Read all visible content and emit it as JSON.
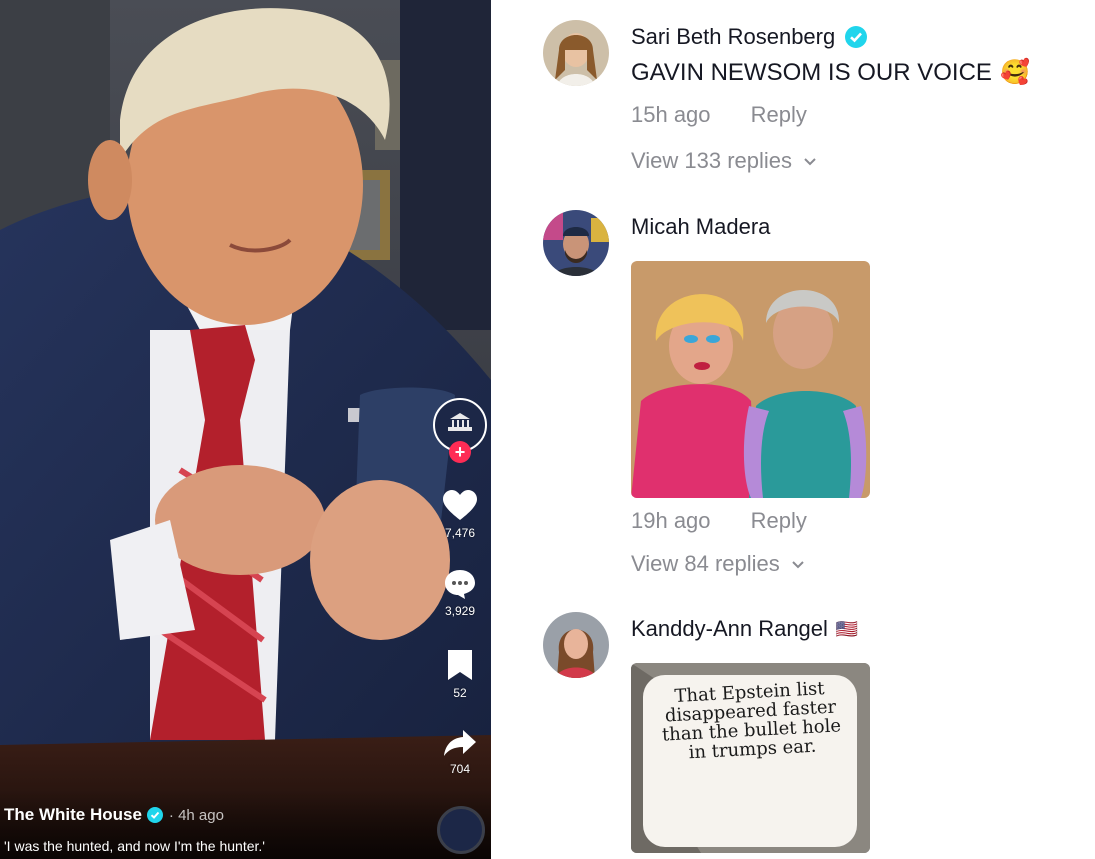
{
  "video": {
    "creator_name": "The White House",
    "posted_time": "· 4h ago",
    "caption": "'I was the hunted, and now I'm the hunter.'",
    "creator_logo_text": "THE WHITE HOUSE",
    "likes": "7,476",
    "comments": "3,929",
    "saves": "52",
    "shares": "704"
  },
  "comments": [
    {
      "author": "Sari Beth Rosenberg",
      "verified": true,
      "text": "GAVIN NEWSOM IS OUR VOICE",
      "emoji": "🥰",
      "time": "15h ago",
      "reply_label": "Reply",
      "view_replies": "View 133 replies"
    },
    {
      "author": "Micah Madera",
      "time": "19h ago",
      "reply_label": "Reply",
      "view_replies": "View 84 replies"
    },
    {
      "author": "Kanddy-Ann Rangel",
      "flag": "🇺🇸",
      "image_text": "That Epstein list disappeared faster than the bullet hole in trumps ear."
    }
  ],
  "icons": {
    "like": "heart-icon",
    "comment": "comment-bubble-icon",
    "save": "bookmark-icon",
    "share": "share-arrow-icon",
    "verified": "verified-badge-icon",
    "chevron": "chevron-down-icon",
    "follow": "plus-icon"
  },
  "colors": {
    "verified_blue": "#20d5ec",
    "follow_red": "#fe2c55",
    "text_primary": "#161823",
    "text_secondary": "#8a8b91"
  }
}
